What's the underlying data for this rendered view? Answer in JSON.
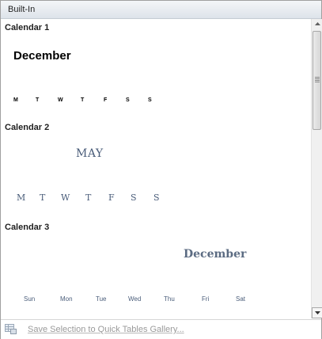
{
  "header": {
    "title": "Built-In"
  },
  "calendars": [
    {
      "label": "Calendar 1",
      "month": "December",
      "weekdays": [
        "M",
        "T",
        "W",
        "T",
        "F",
        "S",
        "S"
      ]
    },
    {
      "label": "Calendar 2",
      "month": "MAY",
      "weekdays": [
        "M",
        "T",
        "W",
        "T",
        "F",
        "S",
        "S"
      ]
    },
    {
      "label": "Calendar 3",
      "month": "December",
      "weekdays": [
        "Sun",
        "Mon",
        "Tue",
        "Wed",
        "Thu",
        "Fri",
        "Sat"
      ]
    }
  ],
  "footer": {
    "action_label": "Save Selection to Quick Tables Gallery...",
    "icon": "table-gallery-icon"
  },
  "colors": {
    "header_bg": "#dde3ea",
    "accent_text": "#4a5d7a",
    "disabled_text": "#9a9a9a"
  }
}
